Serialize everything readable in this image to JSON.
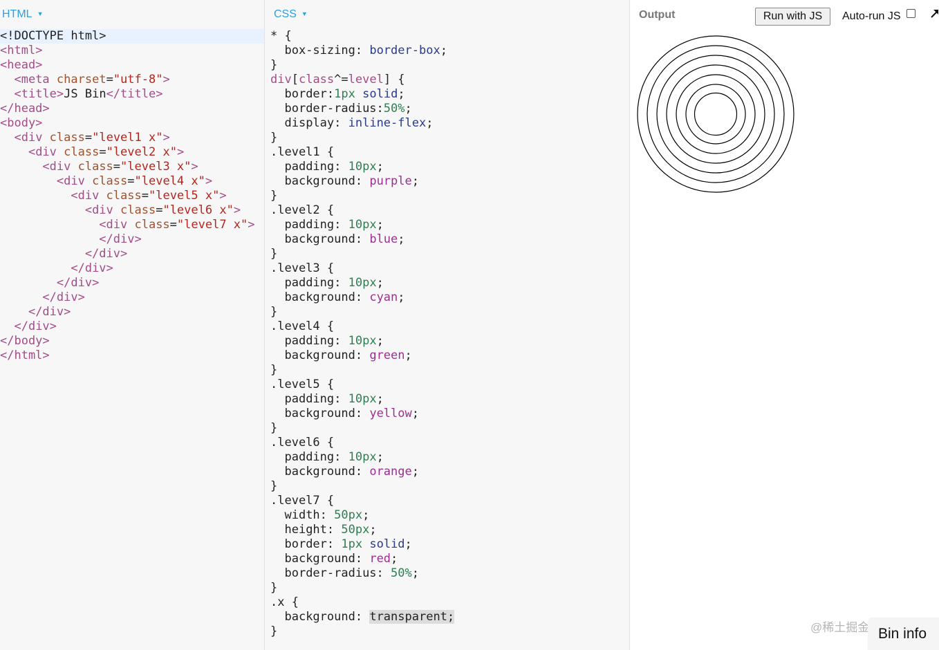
{
  "html_panel": {
    "label": "HTML"
  },
  "css_panel": {
    "label": "CSS"
  },
  "output_panel": {
    "label": "Output",
    "run_button": "Run with JS",
    "autorun_label": "Auto-run JS",
    "autorun_checked": false,
    "ring_count": 7
  },
  "watermark": "@稀土掘金技术社区",
  "bin_info": "Bin info",
  "html_code": [
    [
      [
        "t",
        "<!DOCTYPE html>"
      ]
    ],
    [
      [
        "tag",
        "<html>"
      ]
    ],
    [
      [
        "tag",
        "<head>"
      ]
    ],
    [
      [
        "t",
        "  "
      ],
      [
        "tag",
        "<meta "
      ],
      [
        "attr",
        "charset"
      ],
      [
        "t",
        "="
      ],
      [
        "val",
        "\"utf-8\""
      ],
      [
        "tag",
        ">"
      ]
    ],
    [
      [
        "t",
        "  "
      ],
      [
        "tag",
        "<title>"
      ],
      [
        "t",
        "JS Bin"
      ],
      [
        "tag",
        "</title>"
      ]
    ],
    [
      [
        "tag",
        "</head>"
      ]
    ],
    [
      [
        "tag",
        "<body>"
      ]
    ],
    [
      [
        "t",
        "  "
      ],
      [
        "tag",
        "<div "
      ],
      [
        "attr",
        "class"
      ],
      [
        "t",
        "="
      ],
      [
        "val",
        "\"level1 x\""
      ],
      [
        "tag",
        ">"
      ]
    ],
    [
      [
        "t",
        "    "
      ],
      [
        "tag",
        "<div "
      ],
      [
        "attr",
        "class"
      ],
      [
        "t",
        "="
      ],
      [
        "val",
        "\"level2 x\""
      ],
      [
        "tag",
        ">"
      ]
    ],
    [
      [
        "t",
        "      "
      ],
      [
        "tag",
        "<div "
      ],
      [
        "attr",
        "class"
      ],
      [
        "t",
        "="
      ],
      [
        "val",
        "\"level3 x\""
      ],
      [
        "tag",
        ">"
      ]
    ],
    [
      [
        "t",
        "        "
      ],
      [
        "tag",
        "<div "
      ],
      [
        "attr",
        "class"
      ],
      [
        "t",
        "="
      ],
      [
        "val",
        "\"level4 x\""
      ],
      [
        "tag",
        ">"
      ]
    ],
    [
      [
        "t",
        "          "
      ],
      [
        "tag",
        "<div "
      ],
      [
        "attr",
        "class"
      ],
      [
        "t",
        "="
      ],
      [
        "val",
        "\"level5 x\""
      ],
      [
        "tag",
        ">"
      ]
    ],
    [
      [
        "t",
        "            "
      ],
      [
        "tag",
        "<div "
      ],
      [
        "attr",
        "class"
      ],
      [
        "t",
        "="
      ],
      [
        "val",
        "\"level6 x\""
      ],
      [
        "tag",
        ">"
      ]
    ],
    [
      [
        "t",
        "              "
      ],
      [
        "tag",
        "<div "
      ],
      [
        "attr",
        "class"
      ],
      [
        "t",
        "="
      ],
      [
        "val",
        "\"level7 x\""
      ],
      [
        "tag",
        ">"
      ]
    ],
    [
      [
        "t",
        "              "
      ],
      [
        "tag",
        "</div>"
      ]
    ],
    [
      [
        "t",
        "            "
      ],
      [
        "tag",
        "</div>"
      ]
    ],
    [
      [
        "t",
        "          "
      ],
      [
        "tag",
        "</div>"
      ]
    ],
    [
      [
        "t",
        "        "
      ],
      [
        "tag",
        "</div>"
      ]
    ],
    [
      [
        "t",
        "      "
      ],
      [
        "tag",
        "</div>"
      ]
    ],
    [
      [
        "t",
        "    "
      ],
      [
        "tag",
        "</div>"
      ]
    ],
    [
      [
        "t",
        "  "
      ],
      [
        "tag",
        "</div>"
      ]
    ],
    [
      [
        "tag",
        "</body>"
      ]
    ],
    [
      [
        "tag",
        "</html>"
      ]
    ]
  ],
  "css_code": [
    [
      [
        "t",
        "* {"
      ]
    ],
    [
      [
        "t",
        "  "
      ],
      [
        "prop",
        "box-sizing"
      ],
      [
        "t",
        ": "
      ],
      [
        "kw",
        "border-box"
      ],
      [
        "t",
        ";"
      ]
    ],
    [
      [
        "t",
        "}"
      ]
    ],
    [
      [
        "sel",
        "div"
      ],
      [
        "t",
        "["
      ],
      [
        "sel",
        "class"
      ],
      [
        "t",
        "^="
      ],
      [
        "sel",
        "level"
      ],
      [
        "t",
        "] {"
      ]
    ],
    [
      [
        "t",
        "  "
      ],
      [
        "prop",
        "border"
      ],
      [
        "t",
        ":"
      ],
      [
        "num",
        "1px"
      ],
      [
        "t",
        " "
      ],
      [
        "kw",
        "solid"
      ],
      [
        "t",
        ";"
      ]
    ],
    [
      [
        "t",
        "  "
      ],
      [
        "prop",
        "border-radius"
      ],
      [
        "t",
        ":"
      ],
      [
        "num",
        "50%"
      ],
      [
        "t",
        ";"
      ]
    ],
    [
      [
        "t",
        "  "
      ],
      [
        "prop",
        "display"
      ],
      [
        "t",
        ": "
      ],
      [
        "kw",
        "inline-flex"
      ],
      [
        "t",
        ";"
      ]
    ],
    [
      [
        "t",
        "}"
      ]
    ],
    [
      [
        "t",
        ".level1 {"
      ]
    ],
    [
      [
        "t",
        "  "
      ],
      [
        "prop",
        "padding"
      ],
      [
        "t",
        ": "
      ],
      [
        "num",
        "10px"
      ],
      [
        "t",
        ";"
      ]
    ],
    [
      [
        "t",
        "  "
      ],
      [
        "prop",
        "background"
      ],
      [
        "t",
        ": "
      ],
      [
        "color",
        "purple"
      ],
      [
        "t",
        ";"
      ]
    ],
    [
      [
        "t",
        "}"
      ]
    ],
    [
      [
        "t",
        ".level2 {"
      ]
    ],
    [
      [
        "t",
        "  "
      ],
      [
        "prop",
        "padding"
      ],
      [
        "t",
        ": "
      ],
      [
        "num",
        "10px"
      ],
      [
        "t",
        ";"
      ]
    ],
    [
      [
        "t",
        "  "
      ],
      [
        "prop",
        "background"
      ],
      [
        "t",
        ": "
      ],
      [
        "color",
        "blue"
      ],
      [
        "t",
        ";"
      ]
    ],
    [
      [
        "t",
        "}"
      ]
    ],
    [
      [
        "t",
        ".level3 {"
      ]
    ],
    [
      [
        "t",
        "  "
      ],
      [
        "prop",
        "padding"
      ],
      [
        "t",
        ": "
      ],
      [
        "num",
        "10px"
      ],
      [
        "t",
        ";"
      ]
    ],
    [
      [
        "t",
        "  "
      ],
      [
        "prop",
        "background"
      ],
      [
        "t",
        ": "
      ],
      [
        "color",
        "cyan"
      ],
      [
        "t",
        ";"
      ]
    ],
    [
      [
        "t",
        "}"
      ]
    ],
    [
      [
        "t",
        ".level4 {"
      ]
    ],
    [
      [
        "t",
        "  "
      ],
      [
        "prop",
        "padding"
      ],
      [
        "t",
        ": "
      ],
      [
        "num",
        "10px"
      ],
      [
        "t",
        ";"
      ]
    ],
    [
      [
        "t",
        "  "
      ],
      [
        "prop",
        "background"
      ],
      [
        "t",
        ": "
      ],
      [
        "color",
        "green"
      ],
      [
        "t",
        ";"
      ]
    ],
    [
      [
        "t",
        "}"
      ]
    ],
    [
      [
        "t",
        ".level5 {"
      ]
    ],
    [
      [
        "t",
        "  "
      ],
      [
        "prop",
        "padding"
      ],
      [
        "t",
        ": "
      ],
      [
        "num",
        "10px"
      ],
      [
        "t",
        ";"
      ]
    ],
    [
      [
        "t",
        "  "
      ],
      [
        "prop",
        "background"
      ],
      [
        "t",
        ": "
      ],
      [
        "color",
        "yellow"
      ],
      [
        "t",
        ";"
      ]
    ],
    [
      [
        "t",
        "}"
      ]
    ],
    [
      [
        "t",
        ".level6 {"
      ]
    ],
    [
      [
        "t",
        "  "
      ],
      [
        "prop",
        "padding"
      ],
      [
        "t",
        ": "
      ],
      [
        "num",
        "10px"
      ],
      [
        "t",
        ";"
      ]
    ],
    [
      [
        "t",
        "  "
      ],
      [
        "prop",
        "background"
      ],
      [
        "t",
        ": "
      ],
      [
        "color",
        "orange"
      ],
      [
        "t",
        ";"
      ]
    ],
    [
      [
        "t",
        "}"
      ]
    ],
    [
      [
        "t",
        ".level7 {"
      ]
    ],
    [
      [
        "t",
        "  "
      ],
      [
        "prop",
        "width"
      ],
      [
        "t",
        ": "
      ],
      [
        "num",
        "50px"
      ],
      [
        "t",
        ";"
      ]
    ],
    [
      [
        "t",
        "  "
      ],
      [
        "prop",
        "height"
      ],
      [
        "t",
        ": "
      ],
      [
        "num",
        "50px"
      ],
      [
        "t",
        ";"
      ]
    ],
    [
      [
        "t",
        "  "
      ],
      [
        "prop",
        "border"
      ],
      [
        "t",
        ": "
      ],
      [
        "num",
        "1px"
      ],
      [
        "t",
        " "
      ],
      [
        "kw",
        "solid"
      ],
      [
        "t",
        ";"
      ]
    ],
    [
      [
        "t",
        "  "
      ],
      [
        "prop",
        "background"
      ],
      [
        "t",
        ": "
      ],
      [
        "color",
        "red"
      ],
      [
        "t",
        ";"
      ]
    ],
    [
      [
        "t",
        "  "
      ],
      [
        "prop",
        "border-radius"
      ],
      [
        "t",
        ": "
      ],
      [
        "num",
        "50%"
      ],
      [
        "t",
        ";"
      ]
    ],
    [
      [
        "t",
        "}"
      ]
    ],
    [
      [
        "t",
        ".x {"
      ]
    ],
    [
      [
        "t",
        "  "
      ],
      [
        "prop",
        "background"
      ],
      [
        "t",
        ": "
      ],
      [
        "hl",
        "transparent;"
      ]
    ],
    [
      [
        "t",
        "}"
      ]
    ]
  ]
}
